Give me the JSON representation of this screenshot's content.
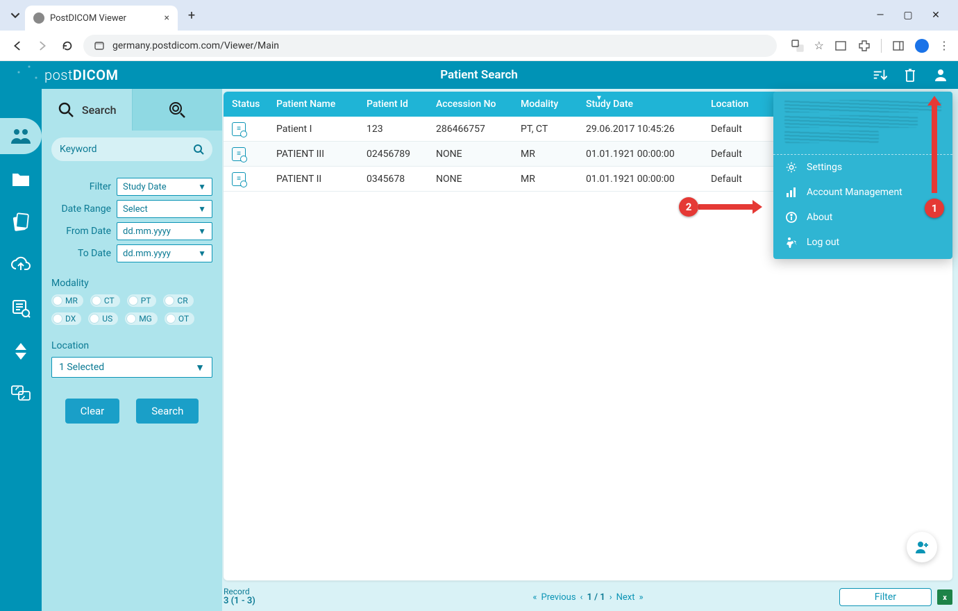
{
  "browser": {
    "tab_title": "PostDICOM Viewer",
    "url": "germany.postdicom.com/Viewer/Main"
  },
  "app": {
    "brand_a": "post",
    "brand_b": "DICOM",
    "page_title": "Patient Search"
  },
  "search": {
    "tab_label": "Search",
    "keyword_placeholder": "Keyword",
    "filter_label": "Filter",
    "filter_value": "Study Date",
    "date_range_label": "Date Range",
    "date_range_value": "Select",
    "from_date_label": "From Date",
    "from_date_value": "dd.mm.yyyy",
    "to_date_label": "To Date",
    "to_date_value": "dd.mm.yyyy",
    "modality_label": "Modality",
    "modalities_row1": [
      "MR",
      "CT",
      "PT",
      "CR"
    ],
    "modalities_row2": [
      "DX",
      "US",
      "MG",
      "OT"
    ],
    "location_label": "Location",
    "location_value": "1 Selected",
    "clear_btn": "Clear",
    "search_btn": "Search"
  },
  "table": {
    "headers": {
      "status": "Status",
      "name": "Patient Name",
      "pid": "Patient Id",
      "acc": "Accession No",
      "mod": "Modality",
      "date": "Study Date",
      "loc": "Location"
    },
    "rows": [
      {
        "name": "Patient I",
        "pid": "123",
        "acc": "286466757",
        "mod": "PT, CT",
        "date": "29.06.2017 10:45:26",
        "loc": "Default"
      },
      {
        "name": "PATIENT III",
        "pid": "02456789",
        "acc": "NONE",
        "mod": "MR",
        "date": "01.01.1921 00:00:00",
        "loc": "Default"
      },
      {
        "name": "PATIENT II",
        "pid": "0345678",
        "acc": "NONE",
        "mod": "MR",
        "date": "01.01.1921 00:00:00",
        "loc": "Default"
      }
    ]
  },
  "footer": {
    "record_label": "Record",
    "record_value": "3 (1 - 3)",
    "prev": "Previous",
    "page": "1 / 1",
    "next": "Next",
    "filter_btn": "Filter"
  },
  "user_menu": {
    "settings": "Settings",
    "account": "Account Management",
    "about": "About",
    "logout": "Log out"
  },
  "annotations": {
    "badge1": "1",
    "badge2": "2"
  }
}
